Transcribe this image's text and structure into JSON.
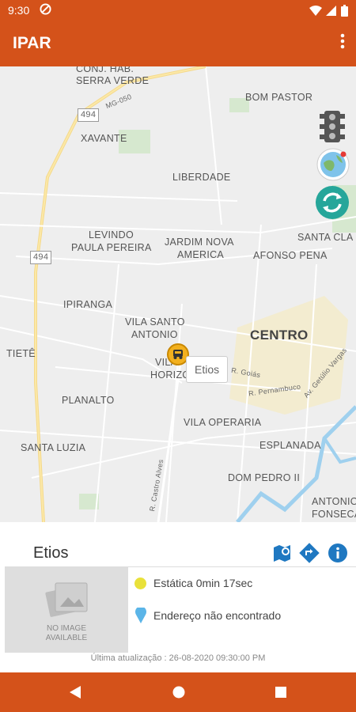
{
  "status_bar": {
    "time": "9:30",
    "dnd_icon": "dnd-icon",
    "right_icons": "wifi signal battery"
  },
  "app_bar": {
    "title": "IPAR",
    "menu_icon": "more-vert-icon"
  },
  "map": {
    "labels": {
      "conj_hab": "CONJ. HAB.",
      "serra_verde": "SERRA VERDE",
      "bom_pastor": "BOM PASTOR",
      "xavante": "XAVANTE",
      "liberdade": "LIBERDADE",
      "levindo": "LEVINDO",
      "paula_pereira": "PAULA PEREIRA",
      "jardim_nova": "JARDIM NOVA",
      "america": "AMERICA",
      "afonso_pena": "AFONSO PENA",
      "santa_cla": "SANTA CLA",
      "ipiranga": "IPIRANGA",
      "vila_santo": "VILA SANTO",
      "antonio": "ANTONIO",
      "centro": "CENTRO",
      "tiete": "TIETÊ",
      "vila": "VILA",
      "horizo": "HORIZO",
      "planalto": "PLANALTO",
      "vila_operaria": "VILA OPERARIA",
      "santa_luzia": "SANTA LUZIA",
      "esplanada": "ESPLANADA",
      "dom_pedro": "DOM PEDRO II",
      "antonio_fonseca_1": "ANTONIO",
      "antonio_fonseca_2": "FONSECA",
      "road_494_a": "494",
      "road_494_b": "494",
      "mg050": "MG-050",
      "castro_alves": "R. Castro Alves",
      "goias": "R. Goiás",
      "pernambuco": "R. Pernambuco",
      "getulio": "Av. Getúlio Vargas"
    },
    "vehicle_popup": "Etios"
  },
  "vehicle": {
    "name": "Etios",
    "no_image_line1": "NO IMAGE",
    "no_image_line2": "AVAILABLE",
    "status": "Estática 0min 17sec",
    "address": "Endereço não encontrado",
    "updated": "Última atualização : 26-08-2020 09:30:00 PM",
    "status_color": "#e9e13a",
    "address_color": "#5bb5e8"
  },
  "colors": {
    "brand": "#d4521a",
    "teal": "#26a69a",
    "action_blue": "#1f78c1"
  }
}
